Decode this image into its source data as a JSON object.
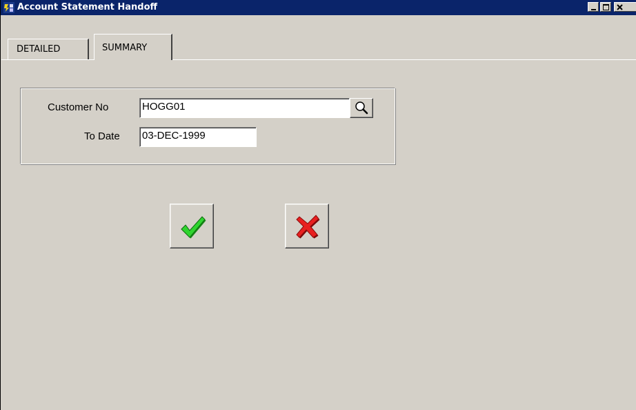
{
  "window": {
    "title": "Account Statement Handoff",
    "icon": "app-icon",
    "controls": [
      "minimize-icon",
      "maximize-icon",
      "close-icon"
    ]
  },
  "tabs": [
    {
      "label": "DETAILED",
      "selected": false
    },
    {
      "label": "SUMMARY",
      "selected": true
    }
  ],
  "form": {
    "customer_no": {
      "label": "Customer No",
      "value": "HOGG01",
      "lookup_icon": "search-icon"
    },
    "to_date": {
      "label": "To Date",
      "value": "03-DEC-1999"
    }
  },
  "actions": {
    "ok_icon": "checkmark-icon",
    "cancel_icon": "cross-icon"
  },
  "colors": {
    "titlebar": "#0a246a",
    "face": "#d4d0c8",
    "ok": "#2fbf2f",
    "cancel": "#e01818"
  }
}
